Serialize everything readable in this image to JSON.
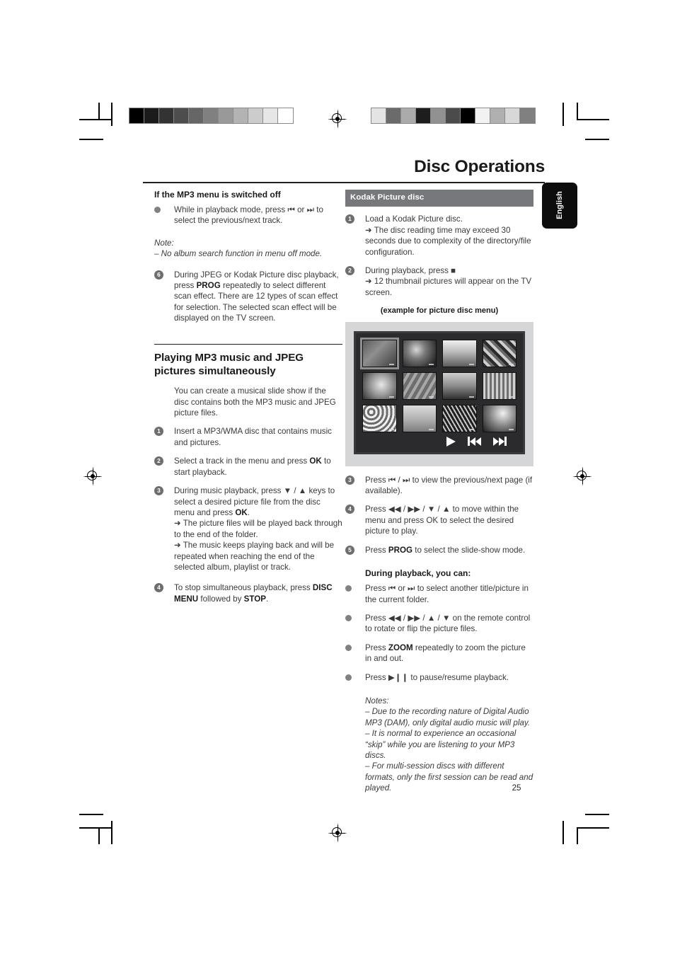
{
  "document": {
    "header_title": "Disc Operations",
    "language_tab": "English",
    "page_number": "25"
  },
  "left_column": {
    "subheading": "If the MP3 menu is switched off",
    "bullet_1": "While in playback mode, press ⏮ or ⏭ to select the previous/next track.",
    "note_label": "Note:",
    "note_item": "–  No album search function in menu off mode.",
    "step_6_number": "6",
    "step_6_text_a": "During JPEG or Kodak Picture disc playback, press ",
    "step_6_bold": "PROG",
    "step_6_text_b": " repeatedly to select different scan effect. There are 12 types of scan effect for selection. The selected scan effect will be displayed on the TV screen.",
    "section_heading_line1": "Playing MP3 music and JPEG",
    "section_heading_line2": "pictures simultaneously",
    "section_intro": "You can create a musical slide show if the disc contains both the MP3 music and JPEG picture files.",
    "steps": [
      {
        "number": "1",
        "text": "Insert a MP3/WMA disc that contains music and pictures."
      },
      {
        "number": "2",
        "text_a": "Select a track in the menu and press ",
        "bold": "OK",
        "text_b": " to start playback."
      },
      {
        "number": "3",
        "text_a": "During music playback, press ▼ / ▲ keys to select a desired picture file from the disc menu and press ",
        "bold": "OK",
        "text_b": ".",
        "results": [
          "➜ The picture files will be played back through to the end of the folder.",
          "➜ The music keeps playing back and will be repeated when reaching the end of the selected album, playlist or track."
        ]
      },
      {
        "number": "4",
        "text_a": "To stop simultaneous playback, press ",
        "bold_1": "DISC MENU",
        "text_b": " followed by ",
        "bold_2": "STOP",
        "text_c": "."
      }
    ]
  },
  "right_column": {
    "banner": "Kodak Picture disc",
    "steps": [
      {
        "number": "1",
        "text": "Load a Kodak Picture disc.",
        "results": [
          "➜ The disc reading time may exceed 30 seconds due to complexity of the directory/file configuration."
        ]
      },
      {
        "number": "2",
        "text": "During playback, press ■",
        "results": [
          "➜ 12 thumbnail pictures will appear on the TV screen."
        ]
      },
      {
        "number": "3",
        "text": "Press ⏮ / ⏭  to view the previous/next page (if available)."
      },
      {
        "number": "4",
        "text": "Press ◀◀ / ▶▶ / ▼ / ▲ to move within the menu and press OK to select the desired picture to play."
      },
      {
        "number": "5",
        "text_a": "Press ",
        "bold": "PROG",
        "text_b": " to select the slide-show mode."
      }
    ],
    "figure_caption": "(example for picture disc menu)",
    "figure": {
      "thumbnail_count": 12,
      "selected_index": 0,
      "controls": [
        "play-icon",
        "previous-icon",
        "next-icon"
      ]
    },
    "during_playback_heading": "During playback, you can:",
    "during_playback_bullets": [
      {
        "text": "Press ⏮ or ⏭  to select another title/picture in the current folder."
      },
      {
        "text": "Press  ◀◀ / ▶▶  /  ▲ / ▼  on the remote control to rotate or flip the picture files."
      },
      {
        "text_a": "Press ",
        "bold": "ZOOM",
        "text_b": " repeatedly to zoom the picture in and out."
      },
      {
        "text": "Press ▶❙❙ to pause/resume playback."
      }
    ],
    "notes_label": "Notes:",
    "notes": [
      "–  Due to the recording nature of Digital Audio MP3 (DAM), only digital audio music will play.",
      "–  It is normal to experience an occasional “skip” while you are listening to your MP3 discs.",
      "–  For multi-session discs with different formats, only the first session can be read and played."
    ]
  },
  "print_marks": {
    "gray_ramp_left": [
      "#000000",
      "#1b1b1b",
      "#333333",
      "#4d4d4d",
      "#666666",
      "#808080",
      "#999999",
      "#b3b3b3",
      "#cccccc",
      "#e6e6e6",
      "#ffffff"
    ],
    "gray_ramp_right": [
      "#e4e4e4",
      "#6b6b6b",
      "#ababab",
      "#1d1d1d",
      "#919191",
      "#4b4b4b",
      "#000000",
      "#f2f2f2",
      "#b0b0b0",
      "#d8d8d8",
      "#808080"
    ]
  }
}
